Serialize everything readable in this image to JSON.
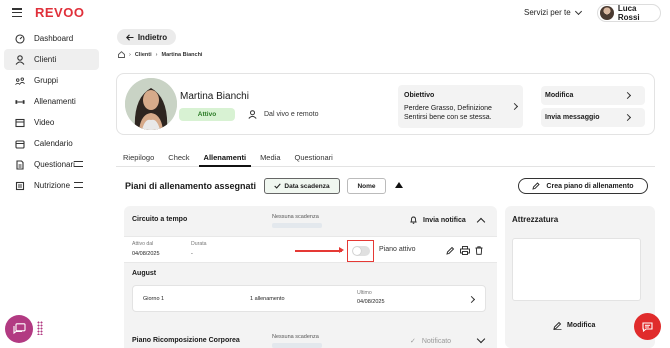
{
  "app": {
    "logo": "REVOO"
  },
  "header": {
    "services_label": "Servizi per te",
    "user_name": "Luca Rossi"
  },
  "sidebar": {
    "items": [
      {
        "label": "Dashboard"
      },
      {
        "label": "Clienti"
      },
      {
        "label": "Gruppi"
      },
      {
        "label": "Allenamenti"
      },
      {
        "label": "Video"
      },
      {
        "label": "Calendario"
      },
      {
        "label": "Questionari"
      },
      {
        "label": "Nutrizione"
      }
    ]
  },
  "back_label": "Indietro",
  "breadcrumb": {
    "items": [
      "Clienti",
      "Martina Bianchi"
    ]
  },
  "profile": {
    "name": "Martina Bianchi",
    "status": "Attivo",
    "mode": "Dal vivo e remoto",
    "objective_title": "Obiettivo",
    "objective_text": "Perdere Grasso, Definizione Sentirsi bene con se stessa.",
    "edit_label": "Modifica",
    "message_label": "Invia messaggio"
  },
  "tabs": [
    "Riepilogo",
    "Check",
    "Allenamenti",
    "Media",
    "Questionari"
  ],
  "section": {
    "title": "Piani di allenamento assegnati",
    "filter_date": "Data scadenza",
    "filter_name": "Nome",
    "create_label": "Crea piano di allenamento"
  },
  "plans": [
    {
      "name": "Circuito a tempo",
      "deadline": "Nessuna scadenza",
      "notify_label": "Invia notifica",
      "active_from_label": "Attivo dal",
      "active_from": "04/08/2025",
      "duration_label": "Durata",
      "duration": "-",
      "toggle_label": "Piano attivo",
      "toggle_on": false,
      "month": "August",
      "days": [
        {
          "day": "Giorno 1",
          "workouts": "1 allenamento",
          "last_label": "Ultimo",
          "last": "04/08/2025"
        }
      ]
    },
    {
      "name": "Piano Ricomposizione Corporea",
      "deadline": "Nessuna scadenza",
      "notified_label": "Notificato"
    }
  ],
  "equipment": {
    "title": "Attrezzatura",
    "edit_label": "Modifica"
  },
  "colors": {
    "brand": "#e0303a",
    "status_bg": "#d8f2d3",
    "status_text": "#2a7a25",
    "highlight": "#e53935",
    "chat_fab": "#b23a82"
  }
}
